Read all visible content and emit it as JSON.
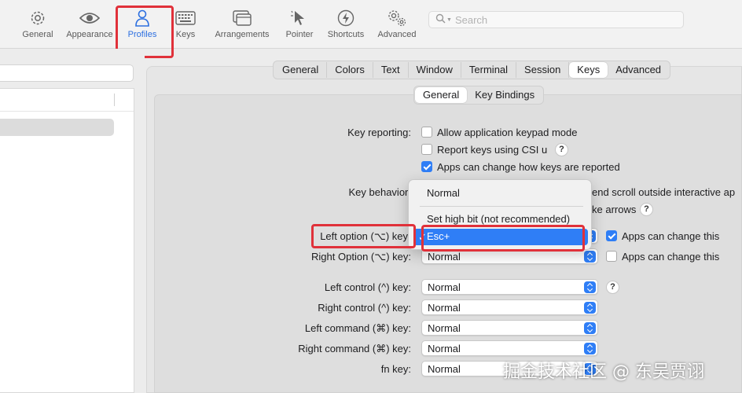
{
  "toolbar": {
    "items": [
      {
        "label": "General",
        "icon": "gear-icon"
      },
      {
        "label": "Appearance",
        "icon": "eye-icon"
      },
      {
        "label": "Profiles",
        "icon": "person-icon",
        "active": true
      },
      {
        "label": "Keys",
        "icon": "keyboard-icon"
      },
      {
        "label": "Arrangements",
        "icon": "windows-icon"
      },
      {
        "label": "Pointer",
        "icon": "pointer-icon"
      },
      {
        "label": "Shortcuts",
        "icon": "bolt-icon"
      },
      {
        "label": "Advanced",
        "icon": "gears-icon"
      }
    ],
    "search_placeholder": "Search"
  },
  "profile_tabs": [
    "General",
    "Colors",
    "Text",
    "Window",
    "Terminal",
    "Session",
    "Keys",
    "Advanced"
  ],
  "profile_tabs_selected": "Keys",
  "keys_subtabs": [
    "General",
    "Key Bindings"
  ],
  "keys_subtabs_selected": "General",
  "key_reporting": {
    "label": "Key reporting:",
    "options": [
      {
        "text": "Allow application keypad mode",
        "checked": false
      },
      {
        "text": "Report keys using CSI u",
        "checked": false,
        "help": "?"
      },
      {
        "text": "Apps can change how keys are reported",
        "checked": true
      }
    ]
  },
  "key_behavior": {
    "label": "Key behavior:",
    "partial_text_1": "end scroll outside interactive ap",
    "partial_text_2": "ke arrows",
    "help": "?"
  },
  "option_menu": {
    "items": [
      "Normal",
      "Set high bit (not recommended)",
      "Esc+"
    ],
    "selected": "Esc+"
  },
  "modifier_keys": [
    {
      "label": "Left option (⌥) key",
      "value": "Esc+",
      "apps_change": "Apps can change this",
      "apps_checked": true
    },
    {
      "label": "Right Option (⌥) key:",
      "value": "Normal",
      "apps_change": "Apps can change this",
      "apps_checked": false
    },
    {
      "label": "Left control (^) key:",
      "value": "Normal",
      "help": "?"
    },
    {
      "label": "Right control (^) key:",
      "value": "Normal"
    },
    {
      "label": "Left command (⌘) key:",
      "value": "Normal"
    },
    {
      "label": "Right command (⌘) key:",
      "value": "Normal"
    },
    {
      "label": "fn key:",
      "value": "Normal"
    }
  ],
  "watermark": "掘金技术社区 @ 东吴贾诩",
  "colors": {
    "accent": "#2f7ef6",
    "highlight_box": "#e0313a"
  }
}
